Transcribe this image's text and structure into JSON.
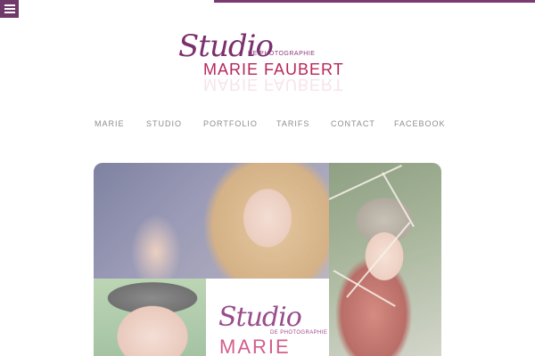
{
  "header": {
    "menu_icon": "hamburger-icon",
    "logo": {
      "script": "Studio",
      "subtitle": "DE PHOTOGRAPHIE",
      "name": "MARIE FAUBERT"
    }
  },
  "nav": {
    "items": [
      {
        "label": "MARIE"
      },
      {
        "label": "STUDIO"
      },
      {
        "label": "PORTFOLIO"
      },
      {
        "label": "TARIFS"
      },
      {
        "label": "CONTACT"
      },
      {
        "label": "FACEBOOK"
      }
    ]
  },
  "gallery": {
    "tile_logo": {
      "script": "Studio",
      "subtitle": "DE PHOTOGRAPHIE",
      "name": "MARIE"
    }
  },
  "colors": {
    "brand_purple": "#7a3a73",
    "brand_pink": "#b8265a",
    "nav_text": "#8d8d8d"
  }
}
